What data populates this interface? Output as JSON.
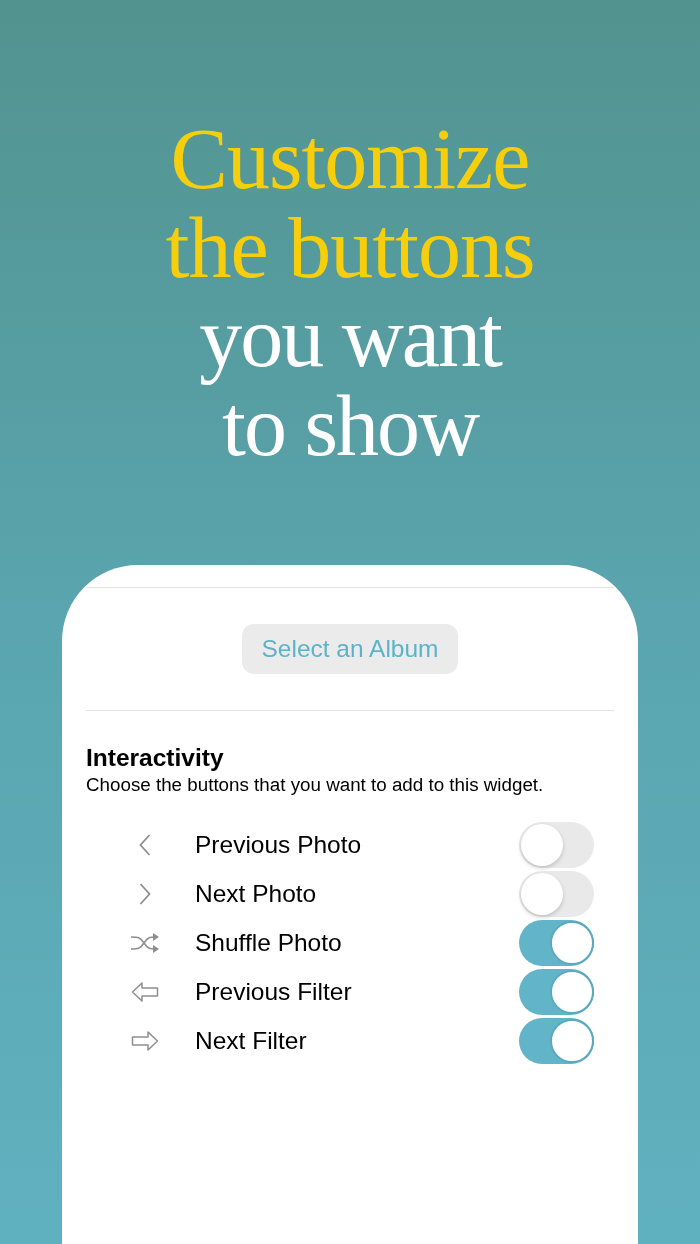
{
  "headline": {
    "lines": [
      {
        "text": "Customize",
        "highlight": true
      },
      {
        "text": "the buttons",
        "highlight": true
      },
      {
        "text": "you want",
        "highlight": false
      },
      {
        "text": "to show",
        "highlight": false
      }
    ]
  },
  "card": {
    "album_button": "Select an Album",
    "section": {
      "title": "Interactivity",
      "description": "Choose the buttons that you want to add to this widget."
    },
    "options": [
      {
        "kind": "chevron-left",
        "label": "Previous Photo",
        "on": false
      },
      {
        "kind": "chevron-right",
        "label": "Next Photo",
        "on": false
      },
      {
        "kind": "shuffle",
        "label": "Shuffle Photo",
        "on": true
      },
      {
        "kind": "arrow-left",
        "label": "Previous Filter",
        "on": true
      },
      {
        "kind": "arrow-right",
        "label": "Next Filter",
        "on": true
      }
    ]
  }
}
